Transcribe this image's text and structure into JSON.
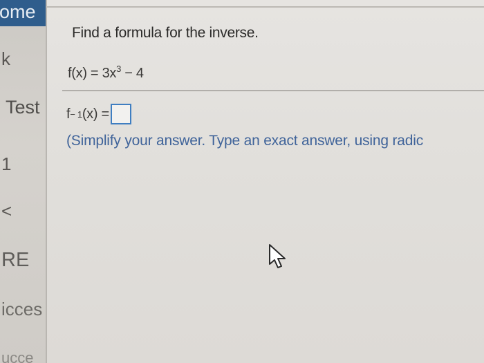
{
  "sidebar": {
    "items": [
      {
        "label": "ome"
      },
      {
        "label": "k"
      },
      {
        "label": "Test"
      },
      {
        "label": "1"
      },
      {
        "label": "<"
      },
      {
        "label": "RE"
      },
      {
        "label": "icces"
      },
      {
        "label": "ucce"
      }
    ]
  },
  "question": {
    "prompt": "Find a formula for the inverse.",
    "function_prefix": "f(x) = 3x",
    "function_exponent": "3",
    "function_suffix": " − 4",
    "answer_prefix": "f",
    "answer_exponent": "− 1",
    "answer_suffix": "(x) =",
    "answer_value": "",
    "hint": "(Simplify your answer. Type an exact answer, using radic"
  },
  "icons": {
    "cursor": "mouse-pointer-icon"
  },
  "colors": {
    "sidebar_header": "#2f5d8c",
    "answer_box_border": "#3f7ec1",
    "hint_text": "#40649a"
  }
}
